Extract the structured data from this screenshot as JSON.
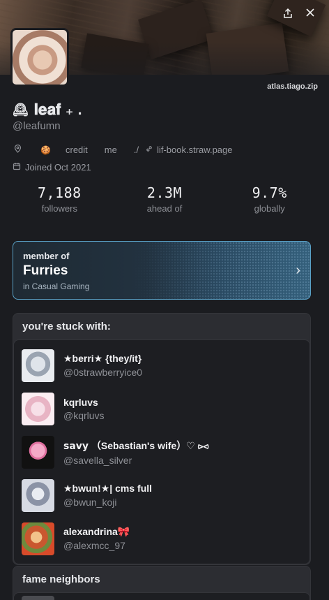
{
  "header": {
    "watermark": "atlas.tiago.zip"
  },
  "profile": {
    "display_name": "𝐥𝐞𝐚𝐟 ₊ .",
    "handle": "@leafumn",
    "bio_items": [
      "credit",
      "me",
      "./"
    ],
    "website": "lif-book.straw.page",
    "joined": "Joined Oct 2021"
  },
  "stats": [
    {
      "value": "7,188",
      "label": "followers"
    },
    {
      "value": "2.3M",
      "label": "ahead of"
    },
    {
      "value": "9.7%",
      "label": "globally"
    }
  ],
  "community": {
    "label": "member of",
    "name": "Furries",
    "category": "in Casual Gaming"
  },
  "stuck_with": {
    "title": "you're stuck with:",
    "users": [
      {
        "name": "★berri★ {they/it}",
        "handle": "@0strawberryice0"
      },
      {
        "name": "kqrluvs",
        "handle": "@kqrluvs"
      },
      {
        "name": "𝘀𝗮𝘃𝘆 （Sebastian's wife）♡ ⪧⪦",
        "handle": "@savella_silver"
      },
      {
        "name": "★bwun!★| cms full",
        "handle": "@bwun_koji"
      },
      {
        "name": "alexandrina🎀",
        "handle": "@alexmcc_97"
      }
    ]
  },
  "fame_neighbors": {
    "title": "fame neighbors"
  },
  "icons": {
    "share": "share-icon",
    "close": "close-icon",
    "location": "location-pin-icon",
    "cookie": "cookie-icon",
    "link": "link-icon",
    "calendar": "calendar-icon",
    "clock": "mantel-clock-icon",
    "chevron": "chevron-right-icon"
  },
  "colors": {
    "background": "#1b1c20",
    "card": "#2c2d32",
    "accent_border": "#5aa2c8"
  }
}
